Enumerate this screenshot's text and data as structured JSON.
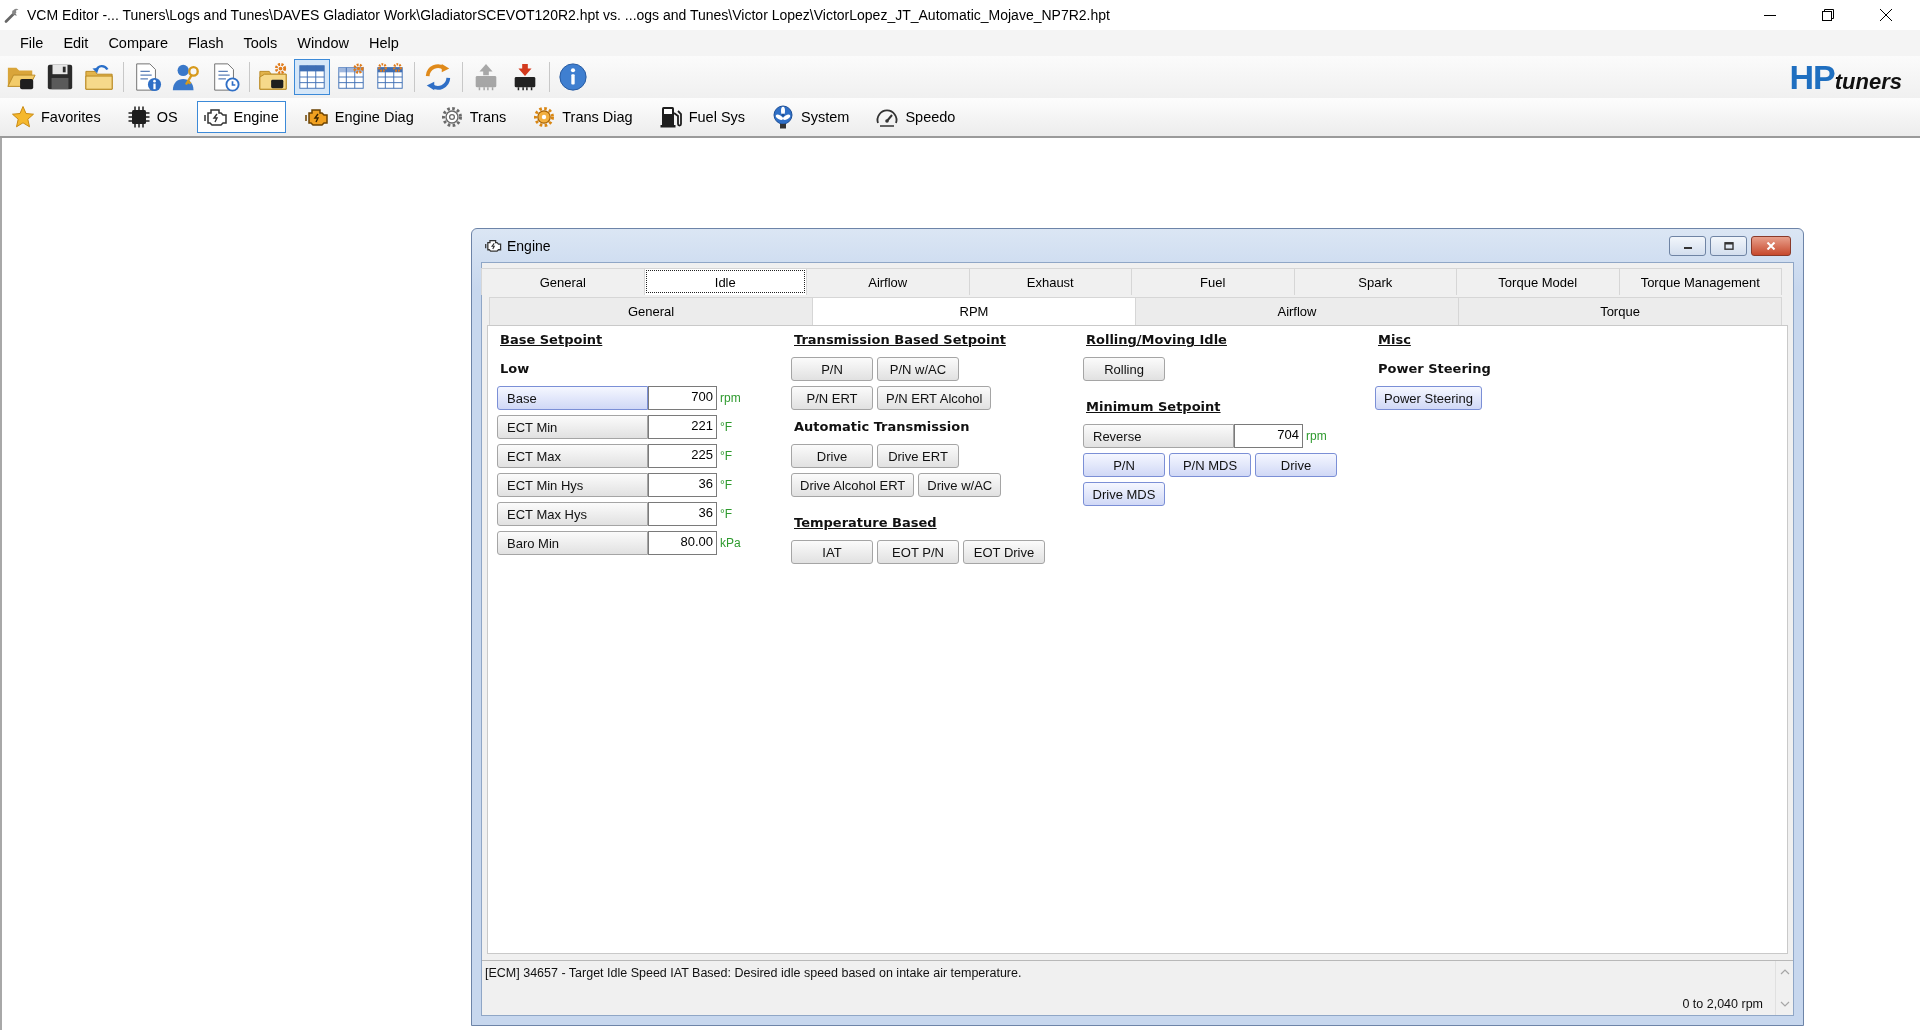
{
  "window": {
    "title": "VCM Editor -... Tuners\\Logs and Tunes\\DAVES Gladiator Work\\GladiatorSCEVOT120R2.hpt vs. ...ogs and Tunes\\Victor Lopez\\VictorLopez_JT_Automatic_Mojave_NP7R2.hpt"
  },
  "menu": [
    "File",
    "Edit",
    "Compare",
    "Flash",
    "Tools",
    "Window",
    "Help"
  ],
  "toolbar": {
    "groups": [
      [
        {
          "pressed": false,
          "disabled": false
        },
        {
          "pressed": false,
          "disabled": false
        },
        {
          "pressed": false,
          "disabled": false
        }
      ],
      [
        {
          "pressed": false,
          "disabled": false
        },
        {
          "pressed": false,
          "disabled": false
        },
        {
          "pressed": false,
          "disabled": false
        }
      ],
      [
        {
          "pressed": false,
          "disabled": false
        },
        {
          "pressed": true,
          "disabled": false
        },
        {
          "pressed": false,
          "disabled": false
        },
        {
          "pressed": false,
          "disabled": false
        }
      ],
      [
        {
          "pressed": false,
          "disabled": false
        }
      ],
      [
        {
          "pressed": false,
          "disabled": true
        },
        {
          "pressed": false,
          "disabled": false
        }
      ],
      [
        {
          "pressed": false,
          "disabled": false
        }
      ]
    ]
  },
  "logo": {
    "emphasis": "HP",
    "rest": "tuners"
  },
  "nav": [
    {
      "label": "Favorites",
      "selected": false
    },
    {
      "label": "OS",
      "selected": false
    },
    {
      "label": "Engine",
      "selected": true
    },
    {
      "label": "Engine Diag",
      "selected": false
    },
    {
      "label": "Trans",
      "selected": false
    },
    {
      "label": "Trans Diag",
      "selected": false
    },
    {
      "label": "Fuel Sys",
      "selected": false
    },
    {
      "label": "System",
      "selected": false
    },
    {
      "label": "Speedo",
      "selected": false
    }
  ],
  "engine_window": {
    "title": "Engine",
    "tabs": [
      {
        "label": "General",
        "selected": false
      },
      {
        "label": "Idle",
        "selected": true
      },
      {
        "label": "Airflow",
        "selected": false
      },
      {
        "label": "Exhaust",
        "selected": false
      },
      {
        "label": "Fuel",
        "selected": false
      },
      {
        "label": "Spark",
        "selected": false
      },
      {
        "label": "Torque Model",
        "selected": false
      },
      {
        "label": "Torque Management",
        "selected": false
      }
    ],
    "subtabs": [
      {
        "label": "General",
        "selected": false
      },
      {
        "label": "RPM",
        "selected": true
      },
      {
        "label": "Airflow",
        "selected": false
      },
      {
        "label": "Torque",
        "selected": false
      }
    ],
    "columns": [
      {
        "blocks": [
          {
            "kind": "heading",
            "text": "Base Setpoint"
          },
          {
            "kind": "subheading",
            "text": "Low"
          },
          {
            "kind": "field",
            "label": "Base",
            "value": "700",
            "unit": "rpm",
            "highlighted": true
          },
          {
            "kind": "field",
            "label": "ECT Min",
            "value": "221",
            "unit": "°F",
            "highlighted": false
          },
          {
            "kind": "field",
            "label": "ECT Max",
            "value": "225",
            "unit": "°F",
            "highlighted": false
          },
          {
            "kind": "field",
            "label": "ECT Min Hys",
            "value": "36",
            "unit": "°F",
            "highlighted": false
          },
          {
            "kind": "field",
            "label": "ECT Max Hys",
            "value": "36",
            "unit": "°F",
            "highlighted": false
          },
          {
            "kind": "field",
            "label": "Baro Min",
            "value": "80.00",
            "unit": "kPa",
            "highlighted": false
          }
        ]
      },
      {
        "blocks": [
          {
            "kind": "heading",
            "text": "Transmission Based Setpoint"
          },
          {
            "kind": "buttons",
            "buttons": [
              {
                "label": "P/N",
                "highlighted": false
              },
              {
                "label": "P/N w/AC",
                "highlighted": false
              }
            ]
          },
          {
            "kind": "buttons",
            "buttons": [
              {
                "label": "P/N ERT",
                "highlighted": false
              },
              {
                "label": "P/N ERT Alcohol",
                "highlighted": false
              }
            ]
          },
          {
            "kind": "subheading",
            "text": "Automatic Transmission"
          },
          {
            "kind": "buttons",
            "buttons": [
              {
                "label": "Drive",
                "highlighted": false
              },
              {
                "label": "Drive ERT",
                "highlighted": false
              }
            ]
          },
          {
            "kind": "buttons",
            "buttons": [
              {
                "label": "Drive Alcohol ERT",
                "highlighted": false
              },
              {
                "label": "Drive w/AC",
                "highlighted": false
              }
            ]
          },
          {
            "kind": "heading",
            "text": "Temperature Based"
          },
          {
            "kind": "buttons",
            "buttons": [
              {
                "label": "IAT",
                "highlighted": false
              },
              {
                "label": "EOT P/N",
                "highlighted": false
              },
              {
                "label": "EOT Drive",
                "highlighted": false
              }
            ]
          }
        ]
      },
      {
        "blocks": [
          {
            "kind": "heading",
            "text": "Rolling/Moving Idle"
          },
          {
            "kind": "buttons",
            "buttons": [
              {
                "label": "Rolling",
                "highlighted": false
              }
            ]
          },
          {
            "kind": "heading",
            "text": "Minimum Setpoint"
          },
          {
            "kind": "field",
            "label": "Reverse",
            "value": "704",
            "unit": "rpm",
            "highlighted": false
          },
          {
            "kind": "buttons",
            "buttons": [
              {
                "label": "P/N",
                "highlighted": true
              },
              {
                "label": "P/N MDS",
                "highlighted": true
              },
              {
                "label": "Drive",
                "highlighted": true
              }
            ]
          },
          {
            "kind": "buttons",
            "buttons": [
              {
                "label": "Drive MDS",
                "highlighted": true
              }
            ]
          }
        ]
      },
      {
        "blocks": [
          {
            "kind": "heading",
            "text": "Misc"
          },
          {
            "kind": "subheading",
            "text": "Power Steering"
          },
          {
            "kind": "buttons",
            "buttons": [
              {
                "label": "Power Steering",
                "highlighted": true
              }
            ]
          }
        ]
      }
    ],
    "status": {
      "description": "[ECM] 34657 - Target Idle Speed IAT Based: Desired idle speed based on intake air temperature.",
      "range": "0 to 2,040 rpm"
    }
  }
}
